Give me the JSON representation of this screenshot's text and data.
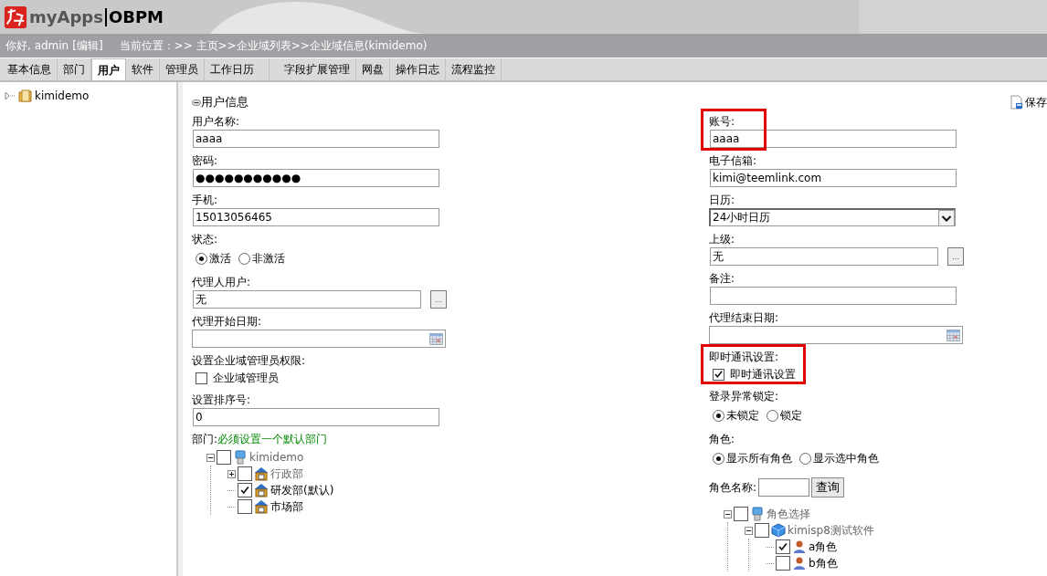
{
  "header": {
    "logo": "myApps",
    "product": "OBPM"
  },
  "infobar": {
    "greeting": "你好, admin",
    "edit_link": "[编辑]",
    "location": "当前位置：>> 主页>>企业域列表>>企业域信息(kimidemo)"
  },
  "tabs": [
    {
      "label": "基本信息",
      "selected": false
    },
    {
      "label": "部门",
      "selected": false
    },
    {
      "label": "用户",
      "selected": true
    },
    {
      "label": "软件",
      "selected": false
    },
    {
      "label": "管理员",
      "selected": false
    },
    {
      "label": "工作日历",
      "selected": false
    },
    {
      "label": "字段扩展管理",
      "selected": false
    },
    {
      "label": "网盘",
      "selected": false
    },
    {
      "label": "操作日志",
      "selected": false
    },
    {
      "label": "流程监控",
      "selected": false
    }
  ],
  "sidebar": {
    "tree": [
      {
        "label": "kimidemo",
        "expanded": false
      }
    ]
  },
  "section": {
    "title": "用户信息",
    "save": "保存"
  },
  "left_fields": [
    {
      "kind": "text",
      "label": "用户名称:",
      "value": "aaaa"
    },
    {
      "kind": "text",
      "label": "密码:",
      "value": "●●●●●●●●●●●"
    },
    {
      "kind": "text",
      "label": "手机:",
      "value": "15013056465"
    },
    {
      "kind": "radio",
      "label": "状态:",
      "options": [
        {
          "label": "激活",
          "selected": true
        },
        {
          "label": "非激活",
          "selected": false
        }
      ]
    },
    {
      "kind": "lookup",
      "label": "代理人用户:",
      "value": "无",
      "button": "..."
    },
    {
      "kind": "date",
      "label": "代理开始日期:"
    },
    {
      "kind": "checkbox",
      "label": "设置企业域管理员权限:",
      "option": {
        "label": "企业域管理员",
        "checked": false
      }
    },
    {
      "kind": "text",
      "label": "设置排序号:",
      "value": "0"
    },
    {
      "kind": "tree",
      "label": "部门:",
      "note": "必须设置一个默认部门",
      "tree": [
        {
          "kind": "server",
          "label": "kimidemo",
          "checked": false,
          "expanded": true,
          "children": [
            {
              "kind": "house",
              "label": "行政部",
              "checked": false,
              "expanded": false
            },
            {
              "kind": "house",
              "label": "研发部(默认)",
              "checked": true
            },
            {
              "kind": "house",
              "label": "市场部",
              "checked": false
            }
          ]
        }
      ]
    }
  ],
  "right_fields": [
    {
      "kind": "text",
      "label": "账号:",
      "value": "aaaa",
      "highlighted": true
    },
    {
      "kind": "text",
      "label": "电子信箱:",
      "value": "kimi@teemlink.com"
    },
    {
      "kind": "select",
      "label": "日历:",
      "value": "24小时日历"
    },
    {
      "kind": "lookup",
      "label": "上级:",
      "value": "无",
      "button": "..."
    },
    {
      "kind": "text",
      "label": "备注:"
    },
    {
      "kind": "date",
      "label": "代理结束日期:"
    },
    {
      "kind": "checkbox",
      "label": "即时通讯设置:",
      "option": {
        "label": "即时通讯设置",
        "checked": true
      },
      "highlighted": true
    },
    {
      "kind": "radio",
      "label": "登录异常锁定:",
      "options": [
        {
          "label": "未锁定",
          "selected": true
        },
        {
          "label": "锁定",
          "selected": false
        }
      ]
    },
    {
      "kind": "radio",
      "label": "角色:",
      "options": [
        {
          "label": "显示所有角色",
          "selected": true
        },
        {
          "label": "显示选中角色",
          "selected": false
        }
      ]
    },
    {
      "kind": "search",
      "label": "角色名称:",
      "button": "查询"
    },
    {
      "kind": "tree",
      "tree": [
        {
          "kind": "server",
          "label": "角色选择",
          "checked": false,
          "expanded": true,
          "children": [
            {
              "kind": "cube",
              "label": "kimisp8测试软件",
              "checked": false,
              "expanded": true,
              "children": [
                {
                  "kind": "person",
                  "label": "a角色",
                  "checked": true
                },
                {
                  "kind": "person",
                  "label": "b角色",
                  "checked": false
                }
              ]
            }
          ]
        }
      ]
    }
  ]
}
